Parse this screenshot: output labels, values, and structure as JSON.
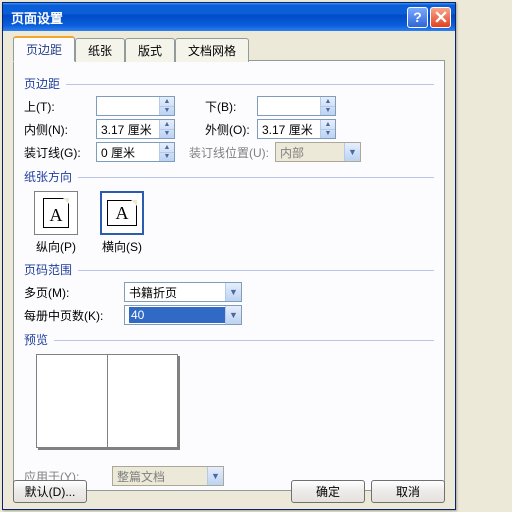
{
  "titlebar": {
    "title": "页面设置"
  },
  "tabs": {
    "t1": "页边距",
    "t2": "纸张",
    "t3": "版式",
    "t4": "文档网格"
  },
  "margins": {
    "group": "页边距",
    "top_label": "上(T):",
    "top_value": "",
    "bottom_label": "下(B):",
    "bottom_value": "",
    "inside_label": "内侧(N):",
    "inside_value": "3.17 厘米",
    "outside_label": "外侧(O):",
    "outside_value": "3.17 厘米",
    "gutter_label": "装订线(G):",
    "gutter_value": "0 厘米",
    "gutter_pos_label": "装订线位置(U):",
    "gutter_pos_value": "内部"
  },
  "orient": {
    "group": "纸张方向",
    "portrait": "纵向(P)",
    "landscape": "横向(S)"
  },
  "pagerange": {
    "group": "页码范围",
    "multi_label": "多页(M):",
    "multi_value": "书籍折页",
    "sheets_label": "每册中页数(K):",
    "sheets_value": "40"
  },
  "preview": {
    "group": "预览",
    "apply_label": "应用于(Y):",
    "apply_value": "整篇文档"
  },
  "buttons": {
    "default": "默认(D)...",
    "ok": "确定",
    "cancel": "取消"
  }
}
